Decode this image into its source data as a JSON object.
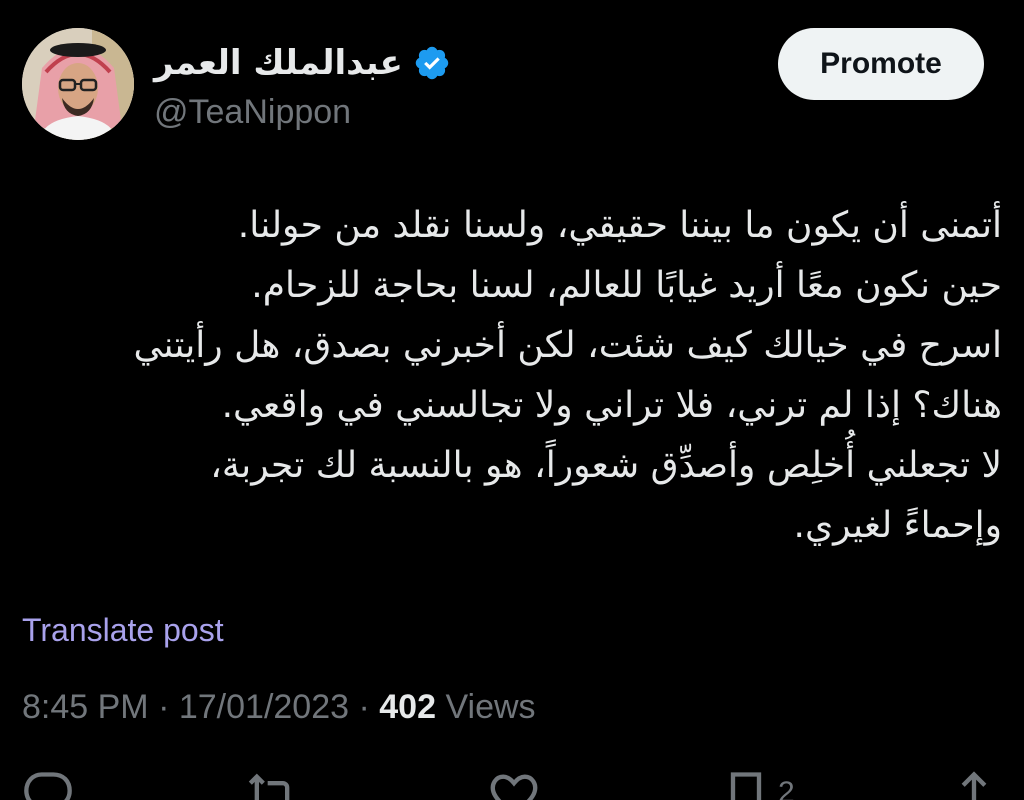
{
  "author": {
    "display_name": "عبدالملك العمر",
    "handle": "@TeaNippon",
    "avatar_icon": "profile-photo",
    "verified_icon": "verified-badge-icon",
    "verified_color": "#1d9bf0"
  },
  "header": {
    "promote_label": "Promote"
  },
  "tweet": {
    "lines": [
      "أتمنى أن يكون ما بيننا حقيقي، ولسنا نقلد من حولنا.",
      "حين نكون معًا أريد غيابًا للعالم، لسنا بحاجة للزحام.",
      "اسرح في خيالك كيف شئت، لكن أخبرني بصدق، هل رأيتني",
      "هناك؟ إذا لم ترني، فلا تراني ولا تجالسني في واقعي.",
      "لا تجعلني أُخلِص وأصدِّق شعوراً، هو بالنسبة لك تجربة،",
      "وإحماءً لغيري."
    ],
    "translate_label": "Translate post",
    "time": "8:45 PM",
    "separator": "·",
    "date": "17/01/2023",
    "views_count": "402",
    "views_label": "Views"
  },
  "actions": {
    "reply_icon": "reply-icon",
    "repost_icon": "repost-icon",
    "like_icon": "like-icon",
    "bookmark_icon": "bookmark-icon",
    "bookmark_count": "2",
    "share_icon": "share-icon"
  },
  "colors": {
    "background": "#000000",
    "text": "#e7e9ea",
    "secondary": "#71767b",
    "translate": "#a9a2ec",
    "button_bg": "#eff3f4"
  }
}
